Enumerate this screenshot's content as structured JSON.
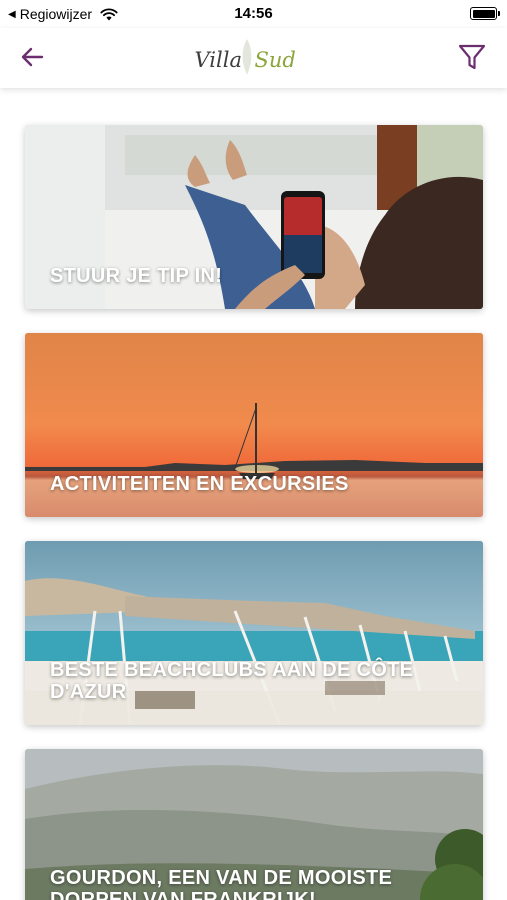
{
  "status_bar": {
    "back_label": "Regiowijzer",
    "time": "14:56"
  },
  "nav": {
    "logo_text_1": "Villa",
    "logo_text_2": "Sud",
    "back_icon": "back-arrow-icon",
    "filter_icon": "filter-icon",
    "accent_color": "#6b2f6f"
  },
  "cards": [
    {
      "title": "STUUR JE TIP IN!"
    },
    {
      "title": "ACTIVITEITEN EN EXCURSIES"
    },
    {
      "title": "BESTE BEACHCLUBS AAN DE CÔTE D'AZUR"
    },
    {
      "title": "GOURDON, EEN VAN DE MOOISTE DORPEN VAN FRANKRIJK!"
    }
  ]
}
